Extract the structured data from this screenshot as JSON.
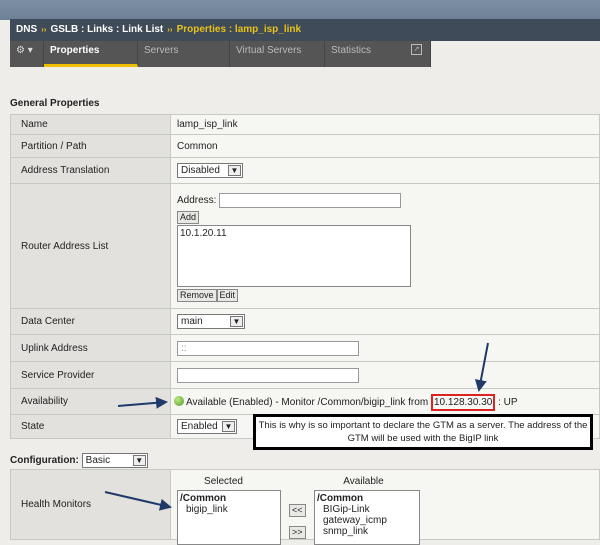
{
  "breadcrumb": {
    "a": "DNS",
    "b": "GSLB : Links : Link List",
    "c": "Properties : lamp_isp_link",
    "sep": "››"
  },
  "tabs": [
    {
      "label": "Properties"
    },
    {
      "label": "Servers"
    },
    {
      "label": "Virtual Servers"
    },
    {
      "label": "Statistics"
    }
  ],
  "general_title": "General Properties",
  "rows": {
    "name": {
      "label": "Name",
      "value": "lamp_isp_link"
    },
    "partition": {
      "label": "Partition / Path",
      "value": "Common"
    },
    "addr_trans": {
      "label": "Address Translation",
      "value": "Disabled"
    },
    "router": {
      "label": "Router Address List",
      "address_label": "Address:",
      "add": "Add",
      "items": [
        "10.1.20.11"
      ],
      "remove": "Remove",
      "edit": "Edit"
    },
    "dc": {
      "label": "Data Center",
      "value": "main"
    },
    "uplink": {
      "label": "Uplink Address",
      "value": "::"
    },
    "provider": {
      "label": "Service Provider",
      "value": ""
    },
    "avail": {
      "label": "Availability",
      "text": "Available (Enabled) - Monitor /Common/bigip_link from",
      "ip": "10.128.30.30",
      "status": ": UP"
    },
    "state": {
      "label": "State",
      "value": "Enabled"
    }
  },
  "note": "This is why is so important to declare the GTM as a server. The address of the GTM will be used with the BigIP link",
  "config": {
    "label": "Configuration:",
    "value": "Basic"
  },
  "health": {
    "label": "Health Monitors",
    "selected_title": "Selected",
    "available_title": "Available",
    "selected": [
      "/Common",
      "bigip_link"
    ],
    "available": [
      "/Common",
      "BIGip-Link",
      "gateway_icmp",
      "snmp_link"
    ],
    "left": "<<",
    "right": ">>"
  }
}
